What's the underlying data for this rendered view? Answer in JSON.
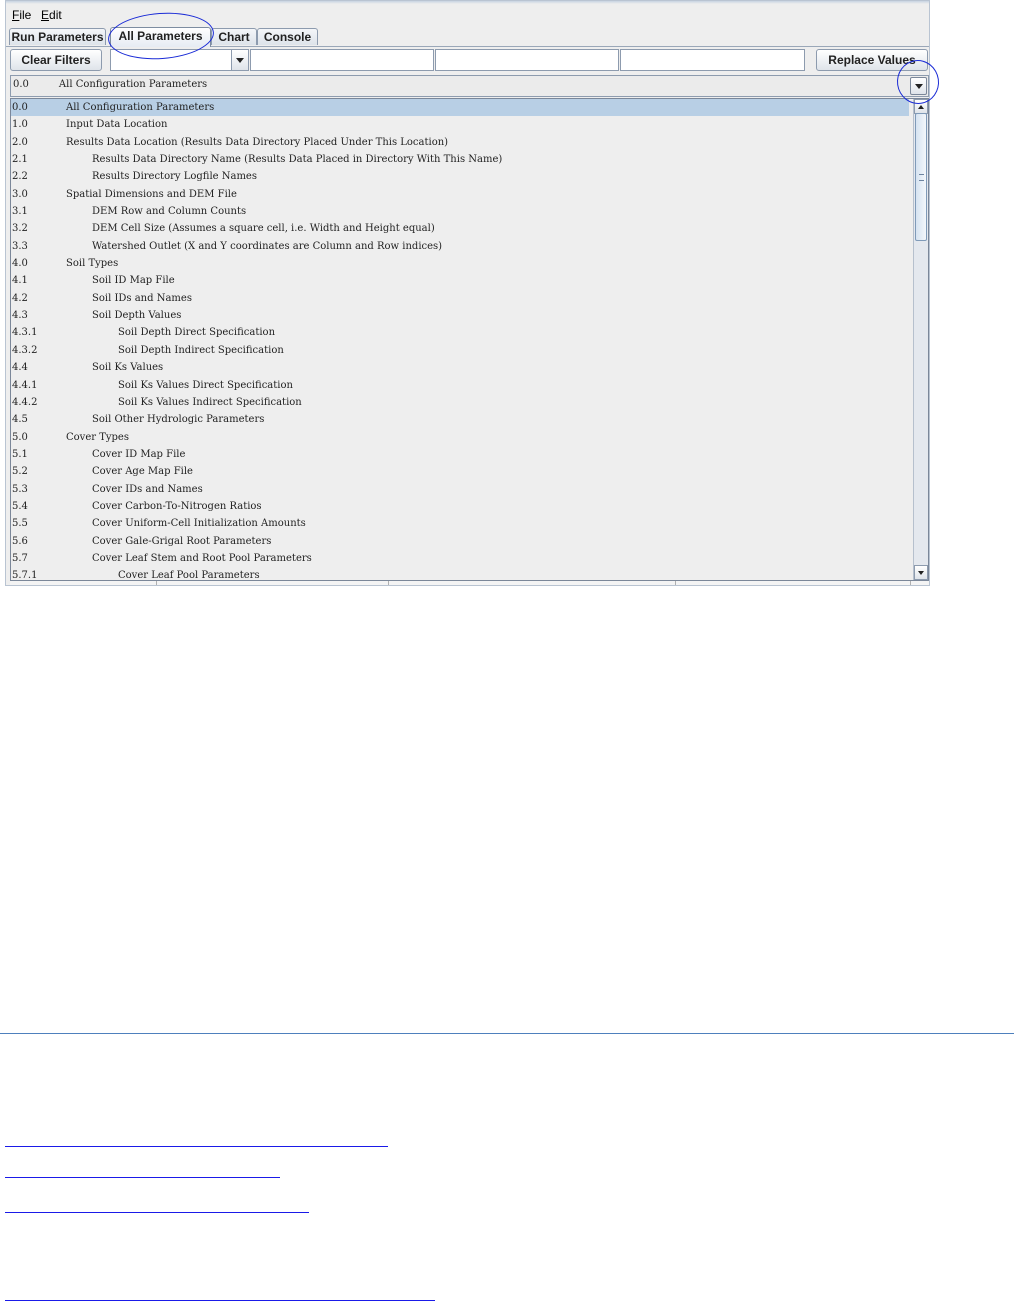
{
  "menubar": {
    "file": "File",
    "edit": "Edit"
  },
  "tabs": [
    "Run Parameters",
    "All Parameters",
    "Chart",
    "Console"
  ],
  "toolbar": {
    "clear_filters": "Clear Filters",
    "replace_values": "Replace Values"
  },
  "combo": {
    "num": "0.0",
    "label": "All Configuration Parameters"
  },
  "list": [
    {
      "num": "0.0",
      "label": "All Configuration Parameters",
      "level": 0,
      "selected": true
    },
    {
      "num": "1.0",
      "label": "Input Data Location",
      "level": 0
    },
    {
      "num": "2.0",
      "label": "Results Data Location (Results Data Directory Placed Under This Location)",
      "level": 0
    },
    {
      "num": "2.1",
      "label": "Results Data Directory Name (Results Data Placed in Directory With This Name)",
      "level": 1
    },
    {
      "num": "2.2",
      "label": "Results Directory Logfile Names",
      "level": 1
    },
    {
      "num": "3.0",
      "label": "Spatial Dimensions and DEM File",
      "level": 0
    },
    {
      "num": "3.1",
      "label": "DEM Row and Column Counts",
      "level": 1
    },
    {
      "num": "3.2",
      "label": "DEM Cell Size (Assumes a square cell, i.e. Width and Height equal)",
      "level": 1
    },
    {
      "num": "3.3",
      "label": "Watershed Outlet (X and Y coordinates are Column and Row indices)",
      "level": 1
    },
    {
      "num": "4.0",
      "label": "Soil Types",
      "level": 0
    },
    {
      "num": "4.1",
      "label": "Soil ID Map File",
      "level": 1
    },
    {
      "num": "4.2",
      "label": "Soil IDs and Names",
      "level": 1
    },
    {
      "num": "4.3",
      "label": "Soil Depth Values",
      "level": 1
    },
    {
      "num": "4.3.1",
      "label": "Soil Depth Direct Specification",
      "level": 2
    },
    {
      "num": "4.3.2",
      "label": "Soil Depth Indirect Specification",
      "level": 2
    },
    {
      "num": "4.4",
      "label": "Soil Ks Values",
      "level": 1
    },
    {
      "num": "4.4.1",
      "label": "Soil Ks Values Direct Specification",
      "level": 2
    },
    {
      "num": "4.4.2",
      "label": "Soil Ks Values Indirect Specification",
      "level": 2
    },
    {
      "num": "4.5",
      "label": "Soil Other Hydrologic Parameters",
      "level": 1
    },
    {
      "num": "5.0",
      "label": "Cover Types",
      "level": 0
    },
    {
      "num": "5.1",
      "label": "Cover ID Map File",
      "level": 1
    },
    {
      "num": "5.2",
      "label": "Cover Age Map File",
      "level": 1
    },
    {
      "num": "5.3",
      "label": "Cover IDs and Names",
      "level": 1
    },
    {
      "num": "5.4",
      "label": "Cover Carbon-To-Nitrogen Ratios",
      "level": 1
    },
    {
      "num": "5.5",
      "label": "Cover Uniform-Cell Initialization Amounts",
      "level": 1
    },
    {
      "num": "5.6",
      "label": "Cover Gale-Grigal Root Parameters",
      "level": 1
    },
    {
      "num": "5.7",
      "label": "Cover Leaf Stem and Root Pool Parameters",
      "level": 1
    },
    {
      "num": "5.7.1",
      "label": "Cover Leaf Pool Parameters",
      "level": 2
    }
  ],
  "colors": {
    "selection": "#b8cfe5",
    "annotation": "#1a2bd6",
    "link": "#1a1ae8",
    "rule": "#4e80bd"
  }
}
